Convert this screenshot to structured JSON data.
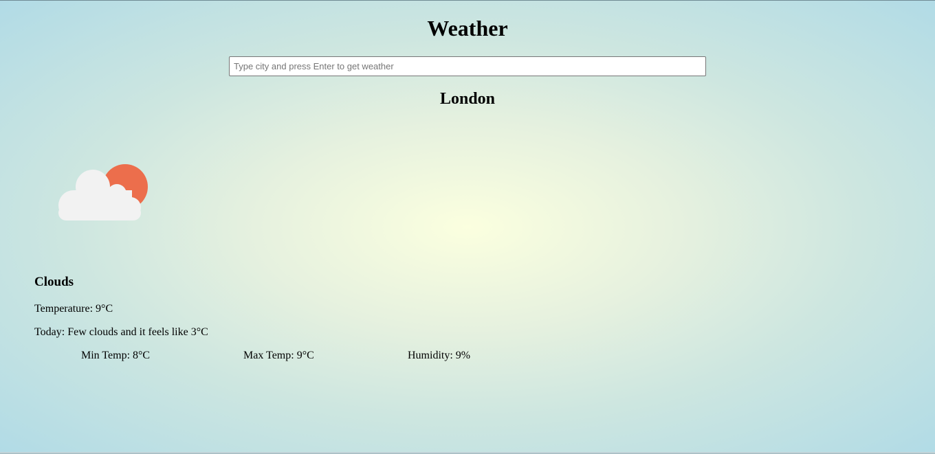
{
  "header": {
    "title": "Weather"
  },
  "search": {
    "placeholder": "Type city and press Enter to get weather",
    "value": ""
  },
  "weather": {
    "city": "London",
    "icon": "partly-cloudy-icon",
    "condition": "Clouds",
    "temperature_text": "Temperature: 9°C",
    "today_text": "Today: Few clouds and it feels like 3°C",
    "min_temp_text": "Min Temp: 8°C",
    "max_temp_text": "Max Temp: 9°C",
    "humidity_text": "Humidity: 9%"
  },
  "colors": {
    "sun": "#ec6e4c",
    "cloud": "#f2f2f2",
    "background_center": "#fbffdf",
    "background_edge": "#b1dbe6"
  }
}
